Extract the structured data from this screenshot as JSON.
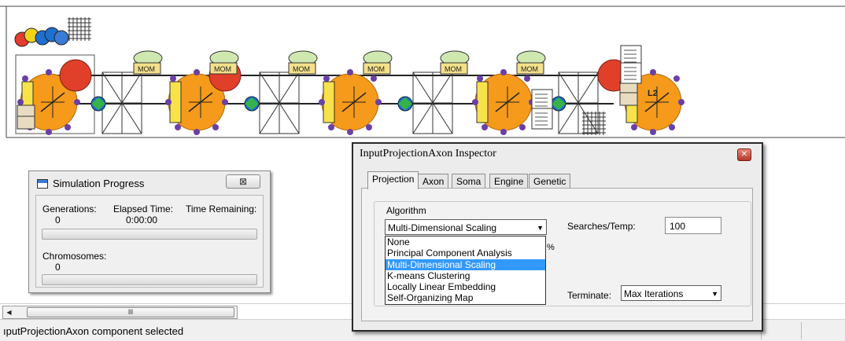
{
  "simulation_progress": {
    "title": "Simulation Progress",
    "close_glyph": "⊠",
    "generations_label": "Generations:",
    "generations_value": "0",
    "elapsed_label": "Elapsed Time:",
    "elapsed_value": "0:00:00",
    "remaining_label": "Time Remaining:",
    "chromosomes_label": "Chromosomes:",
    "chromosomes_value": "0"
  },
  "scrollbar": {
    "left_arrow": "◀",
    "thumb_grip": "lll"
  },
  "status_bar": {
    "text": "ıputProjectionAxon component selected"
  },
  "network": {
    "mom_label": "MOM",
    "l2_label": "L2",
    "colors": {
      "soma": "#f59a1a",
      "neuron_red": "#e0402a",
      "dot_purple": "#6a3fa8",
      "node_blue": "#1f6fcf",
      "node_green": "#35b34a",
      "axon_yellow": "#f7e24a"
    },
    "icons": [
      "clock-icons",
      "grid-icon",
      "mom-probe-icon",
      "neuron-soma-icon",
      "crossbar-synapse-icon",
      "file-cabinet-icon",
      "report-icon"
    ]
  },
  "inspector": {
    "title": "InputProjectionAxon Inspector",
    "close_glyph": "✕",
    "tabs": [
      "Projection",
      "Axon",
      "Soma",
      "Engine",
      "Genetic"
    ],
    "active_tab": "Projection",
    "algorithm_label": "Algorithm",
    "algorithm_value": "Multi-Dimensional Scaling",
    "algorithm_options": [
      "None",
      "Principal Component Analysis",
      "Multi-Dimensional Scaling",
      "K-means Clustering",
      "Locally Linear Embedding",
      "Self-Organizing Map"
    ],
    "selected_option_index": 2,
    "searches_label": "Searches/Temp:",
    "searches_value": "100",
    "percent_glyph": "%",
    "terminate_label": "Terminate:",
    "terminate_value": "Max Iterations"
  }
}
